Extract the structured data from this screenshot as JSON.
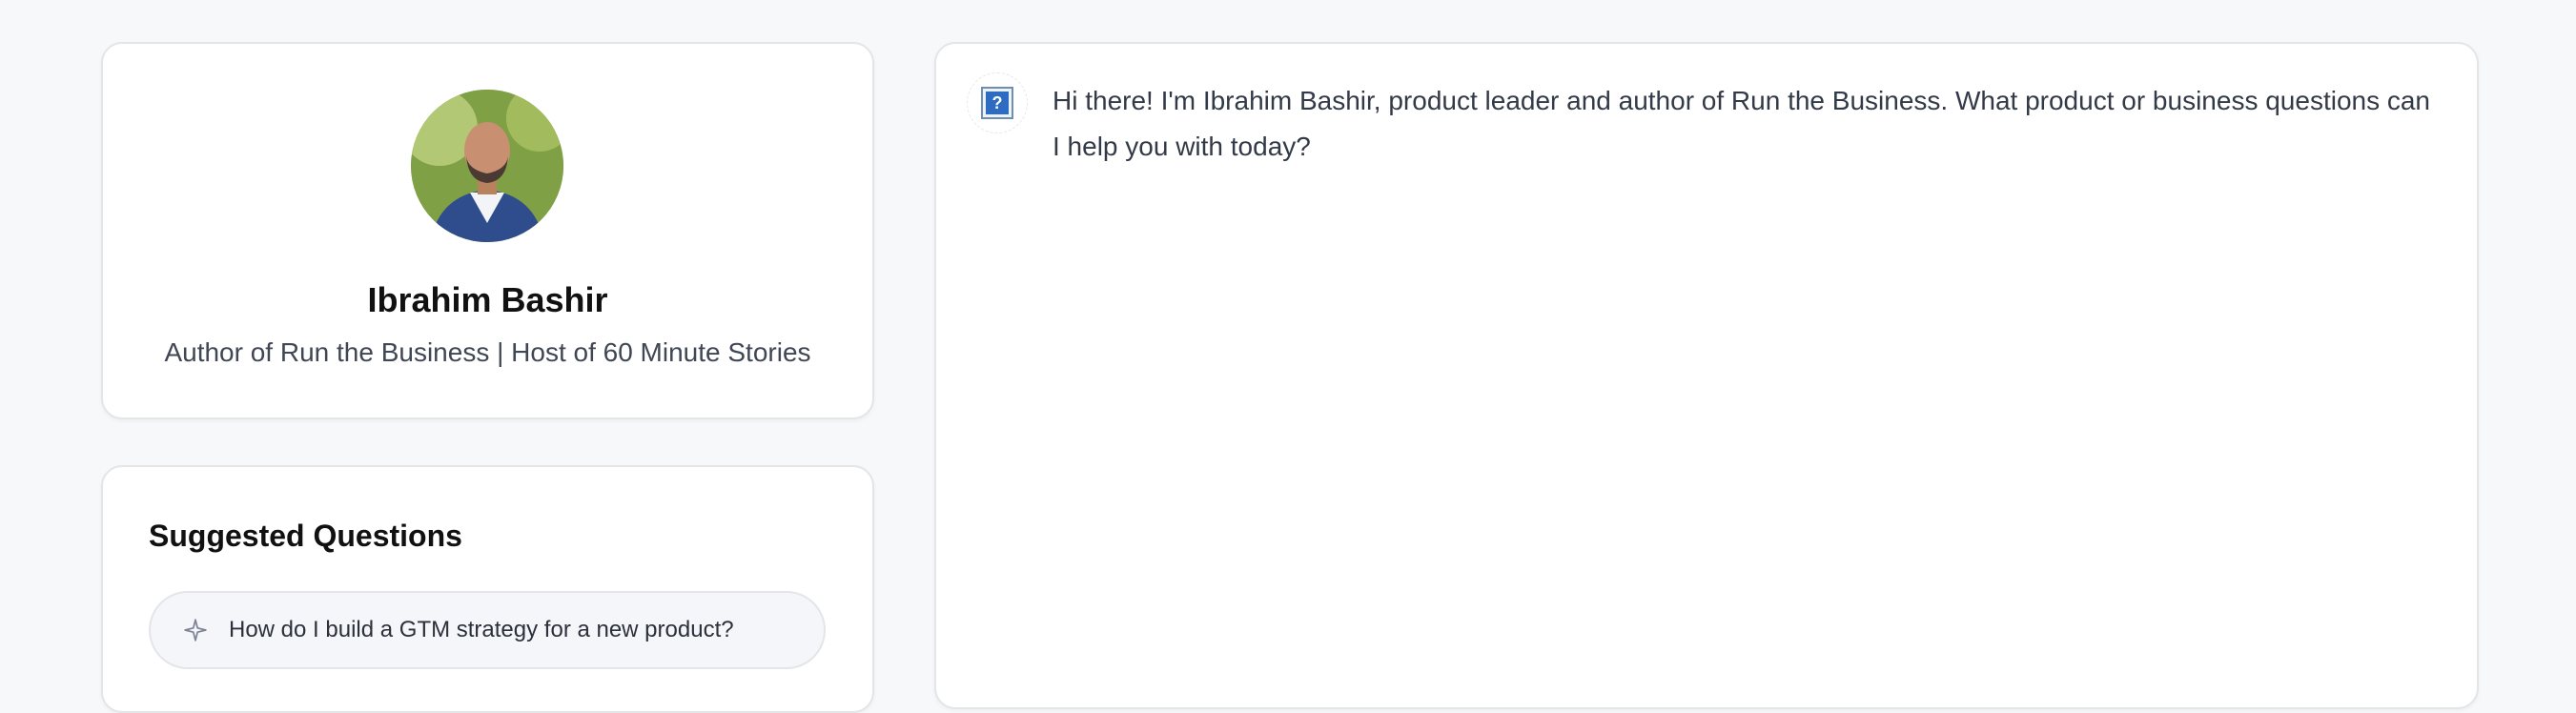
{
  "profile": {
    "name": "Ibrahim Bashir",
    "subtitle": "Author of Run the Business | Host of 60 Minute Stories",
    "avatar_icon": "profile-photo"
  },
  "suggested": {
    "title": "Suggested Questions",
    "questions": [
      {
        "icon": "sparkle-icon",
        "text": "How do I build a GTM strategy for a new product?"
      }
    ]
  },
  "chat": {
    "messages": [
      {
        "role": "assistant",
        "avatar_icon": "broken-image-icon",
        "text": "Hi there! I'm Ibrahim Bashir, product leader and author of Run the Business. What product or business questions can I help you with today?"
      }
    ]
  },
  "colors": {
    "page_bg": "#f7f8fa",
    "card_bg": "#ffffff",
    "card_border": "#e3e5e9",
    "pill_bg": "#f5f6f9",
    "text_primary": "#111111",
    "text_secondary": "#3f4654"
  }
}
